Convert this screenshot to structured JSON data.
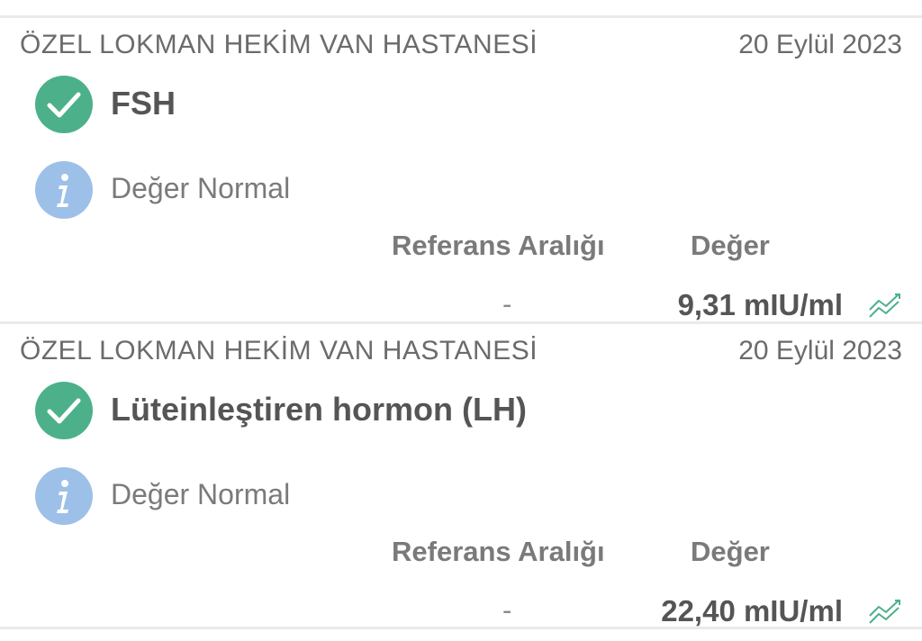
{
  "results": [
    {
      "hospital": "ÖZEL LOKMAN HEKİM VAN HASTANESİ",
      "date": "20 Eylül 2023",
      "test_name": "FSH",
      "status": "Değer Normal",
      "ref_header": "Referans Aralığı",
      "value_header": "Değer",
      "ref_value": "-",
      "value": "9,31 mIU/ml"
    },
    {
      "hospital": "ÖZEL LOKMAN HEKİM VAN HASTANESİ",
      "date": "20 Eylül 2023",
      "test_name": "Lüteinleştiren hormon (LH)",
      "status": "Değer Normal",
      "ref_header": "Referans Aralığı",
      "value_header": "Değer",
      "ref_value": "-",
      "value": "22,40 mIU/ml"
    }
  ],
  "colors": {
    "check": "#4cb18a",
    "info": "#9dc0e8",
    "trend": "#4cb18a"
  },
  "icons": {
    "check": "checkmark-circle-icon",
    "info": "info-circle-icon",
    "trend": "trend-chart-icon"
  }
}
